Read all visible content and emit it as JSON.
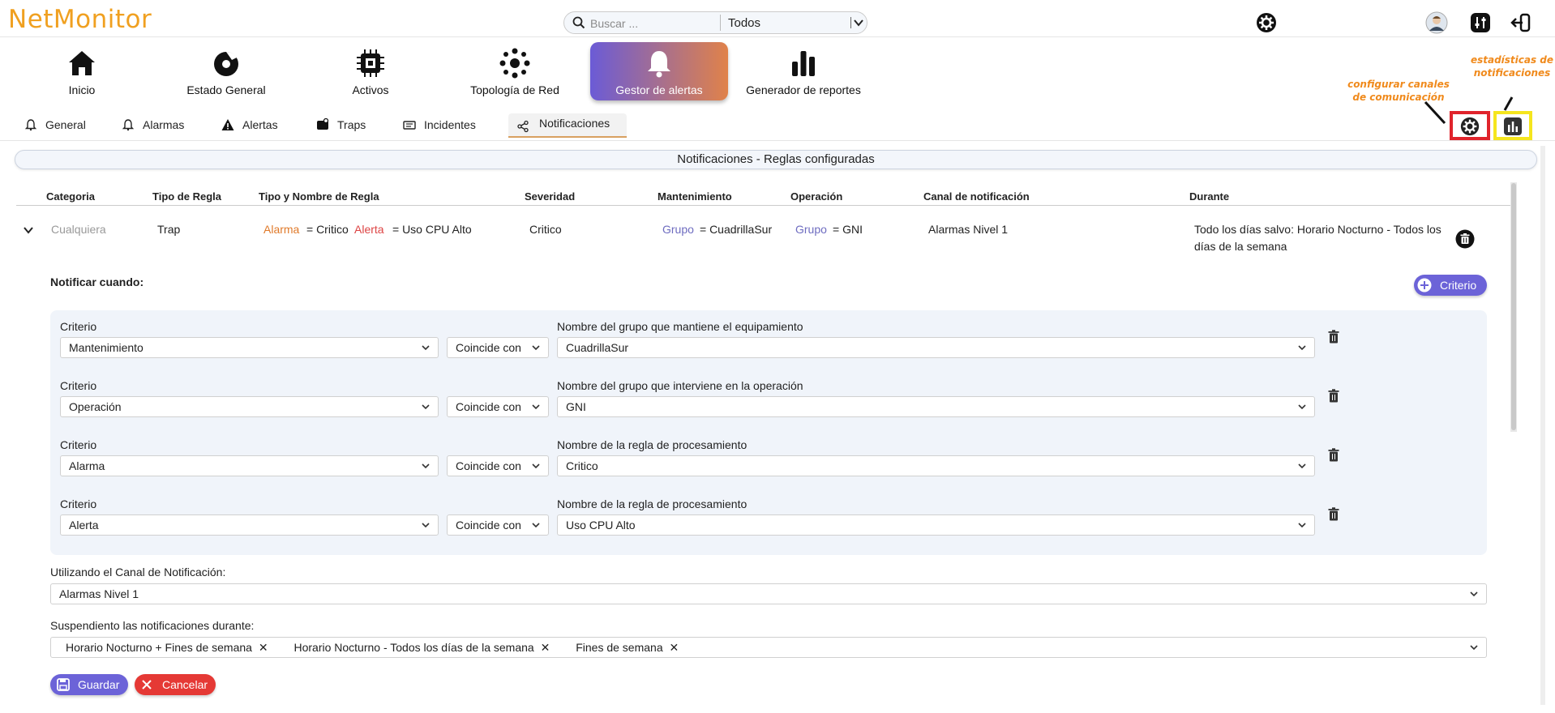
{
  "app": {
    "logo": "NetMonitor"
  },
  "search": {
    "placeholder": "Buscar ...",
    "scope": "Todos"
  },
  "modules": [
    {
      "label": "Inicio"
    },
    {
      "label": "Estado General"
    },
    {
      "label": "Activos"
    },
    {
      "label": "Topología de Red"
    },
    {
      "label": "Gestor de alertas"
    },
    {
      "label": "Generador de reportes"
    }
  ],
  "subtabs": [
    {
      "label": "General"
    },
    {
      "label": "Alarmas"
    },
    {
      "label": "Alertas"
    },
    {
      "label": "Traps"
    },
    {
      "label": "Incidentes"
    },
    {
      "label": "Notificaciones"
    }
  ],
  "annotations": {
    "channels": [
      "configurar canales",
      "de comunicación"
    ],
    "stats": [
      "estadísticas de",
      "notificaciones"
    ]
  },
  "panel": {
    "title": "Notificaciones - Reglas configuradas"
  },
  "table": {
    "headers": [
      "Categoria",
      "Tipo de Regla",
      "Tipo y Nombre de Regla",
      "Severidad",
      "Mantenimiento",
      "Operación",
      "Canal de notificación",
      "Durante"
    ],
    "row": {
      "categoria": "Cualquiera",
      "tipo": "Trap",
      "alarma_key": "Alarma",
      "alarma_val": "= Critico",
      "alerta_key": "Alerta",
      "alerta_val": "= Uso CPU Alto",
      "severidad": "Critico",
      "mant_key": "Grupo",
      "mant_val": "= CuadrillaSur",
      "oper_key": "Grupo",
      "oper_val": "= GNI",
      "canal": "Alarmas Nivel 1",
      "durante_1": "Todo los días salvo: Horario Nocturno - Todos los",
      "durante_2": "días de la semana"
    }
  },
  "notify": {
    "title": "Notificar cuando:",
    "add_button": "Criterio",
    "criteria": [
      {
        "label": "Criterio",
        "value": "Mantenimiento",
        "op": "Coincide con",
        "field_label": "Nombre del grupo que mantiene el equipamiento",
        "field_value": "CuadrillaSur"
      },
      {
        "label": "Criterio",
        "value": "Operación",
        "op": "Coincide con",
        "field_label": "Nombre del grupo que interviene en la operación",
        "field_value": "GNI"
      },
      {
        "label": "Criterio",
        "value": "Alarma",
        "op": "Coincide con",
        "field_label": "Nombre de la regla de procesamiento",
        "field_value": "Critico"
      },
      {
        "label": "Criterio",
        "value": "Alerta",
        "op": "Coincide con",
        "field_label": "Nombre de la regla de procesamiento",
        "field_value": "Uso CPU Alto"
      }
    ]
  },
  "channel": {
    "label": "Utilizando el Canal de Notificación:",
    "value": "Alarmas Nivel 1"
  },
  "suspend": {
    "label": "Suspendiento las notificaciones durante:",
    "chips": [
      "Horario Nocturno + Fines de semana",
      "Horario Nocturno - Todos los días de la semana",
      "Fines de semana"
    ]
  },
  "actions": {
    "save": "Guardar",
    "cancel": "Cancelar"
  },
  "colors": {
    "accent_orange": "#f0a020",
    "accent_purple": "#6b5bd6",
    "danger": "#e53935"
  }
}
